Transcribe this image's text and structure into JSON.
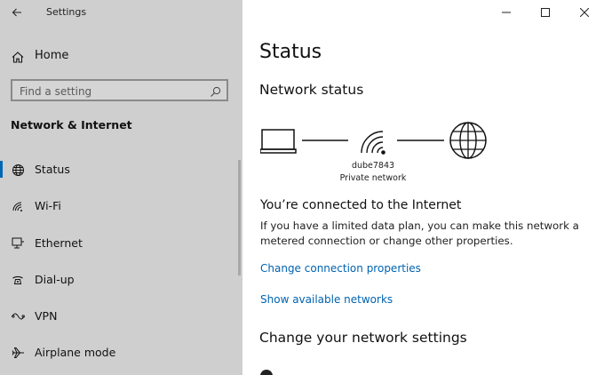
{
  "window": {
    "title": "Settings",
    "caption": {
      "minimize": "–",
      "maximize": "☐",
      "close": "✕"
    }
  },
  "sidebar": {
    "home_label": "Home",
    "search": {
      "placeholder": "Find a setting"
    },
    "section_title": "Network & Internet",
    "items": [
      {
        "label": "Status",
        "icon": "globe-status-icon",
        "selected": true
      },
      {
        "label": "Wi-Fi",
        "icon": "wifi-icon"
      },
      {
        "label": "Ethernet",
        "icon": "ethernet-icon"
      },
      {
        "label": "Dial-up",
        "icon": "dialup-icon"
      },
      {
        "label": "VPN",
        "icon": "vpn-icon"
      },
      {
        "label": "Airplane mode",
        "icon": "airplane-icon"
      }
    ]
  },
  "main": {
    "page_title": "Status",
    "network_status_heading": "Network status",
    "network": {
      "name": "dube7843",
      "type": "Private network"
    },
    "connected_heading": "You’re connected to the Internet",
    "description": "If you have a limited data plan, you can make this network a metered connection or change other properties.",
    "links": {
      "change_connection": "Change connection properties",
      "show_networks": "Show available networks"
    },
    "change_settings_heading": "Change your network settings"
  },
  "colors": {
    "accent": "#0066b4",
    "link": "#0063b1",
    "sidebar_bg": "#cfcfcf"
  }
}
